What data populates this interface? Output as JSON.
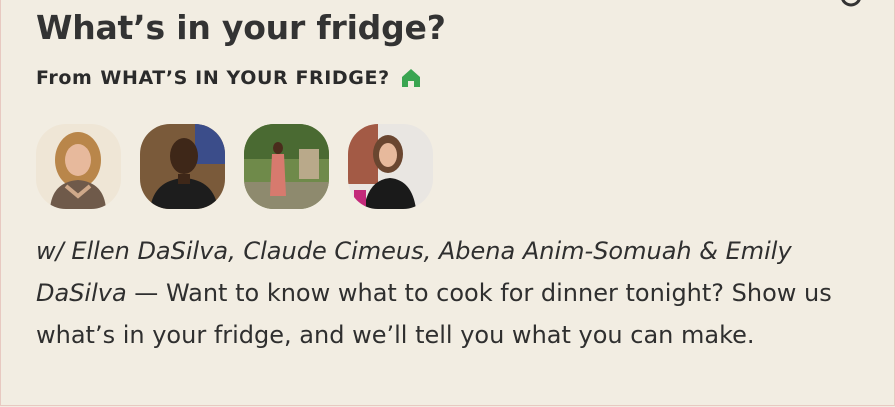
{
  "card": {
    "title": "What’s in your fridge?",
    "from_label": "From",
    "show_name": "WHAT’S IN YOUR FRIDGE?",
    "house_icon": "house-icon",
    "accent_green": "#3aa551",
    "names": "w/ Ellen DaSilva, Claude Cimeus, Abena Anim-Somuah & Emily DaSilva",
    "separator": " — ",
    "description": "Want to know what to cook for dinner tonight? Show us what’s in your fridge, and we’ll tell you what you can make."
  },
  "hosts": [
    {
      "name": "Ellen DaSilva"
    },
    {
      "name": "Claude Cimeus"
    },
    {
      "name": "Abena Anim-Somuah"
    },
    {
      "name": "Emily DaSilva"
    }
  ]
}
